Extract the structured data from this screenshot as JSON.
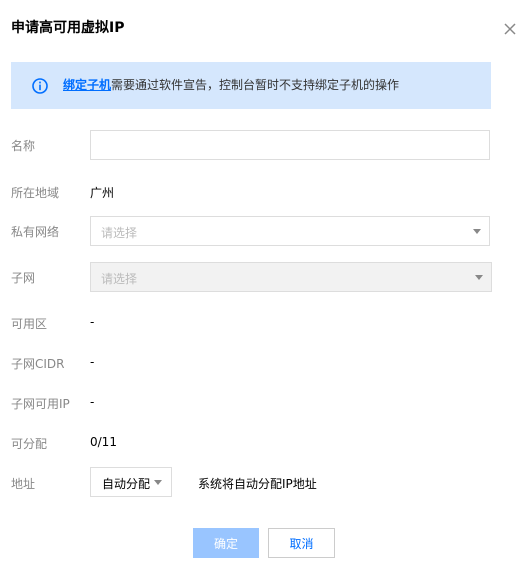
{
  "dialog": {
    "title": "申请高可用虚拟IP"
  },
  "notice": {
    "link_text": "绑定子机",
    "message": "需要通过软件宣告，控制台暂时不支持绑定子机的操作"
  },
  "form": {
    "name": {
      "label": "名称",
      "value": "",
      "placeholder": ""
    },
    "region": {
      "label": "所在地域",
      "value": "广州"
    },
    "vpc": {
      "label": "私有网络",
      "placeholder": "请选择"
    },
    "subnet": {
      "label": "子网",
      "placeholder": "请选择"
    },
    "zone": {
      "label": "可用区",
      "value": "-"
    },
    "subnet_cidr": {
      "label": "子网CIDR",
      "value": "-"
    },
    "subnet_ip": {
      "label": "子网可用IP",
      "value": "-"
    },
    "allocatable": {
      "label": "可分配",
      "value": "0/11"
    },
    "address": {
      "label": "地址",
      "mode": "自动分配",
      "hint": "系统将自动分配IP地址"
    }
  },
  "buttons": {
    "ok": "确定",
    "cancel": "取消"
  },
  "colors": {
    "accent": "#006eff",
    "notice_bg": "#d5e7fd",
    "ok_disabled": "#99c5ff"
  }
}
